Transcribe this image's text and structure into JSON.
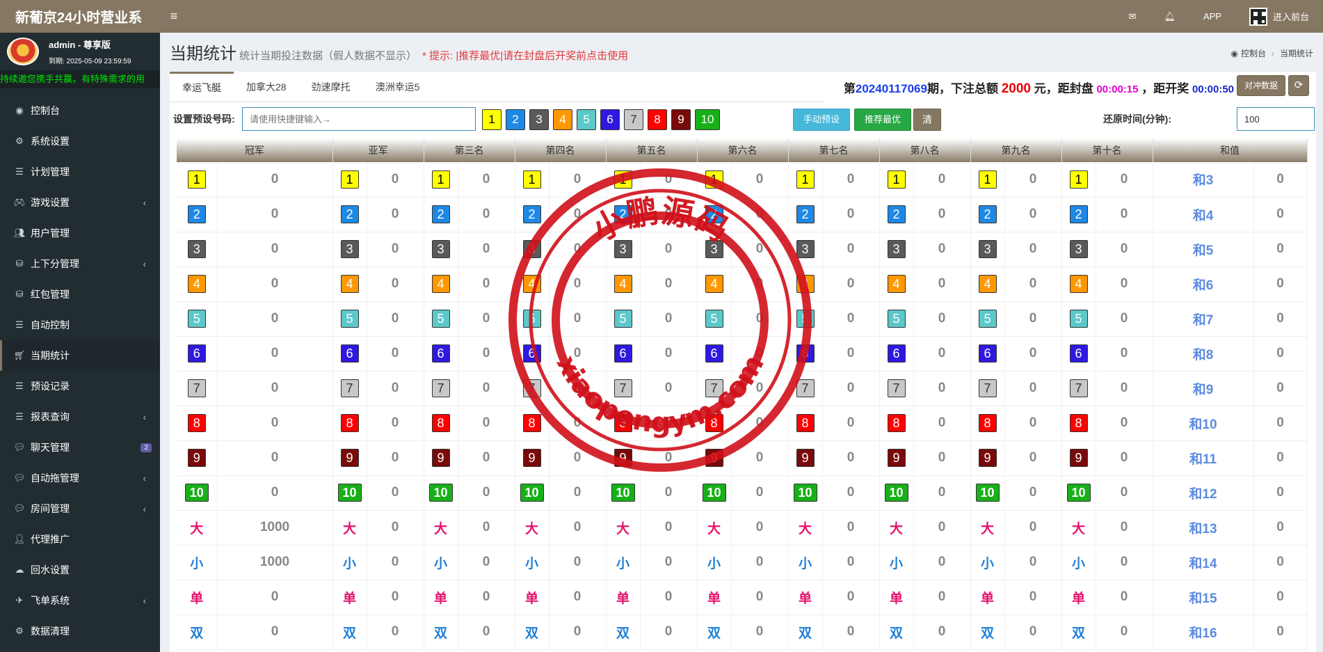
{
  "app": {
    "title": "新葡京24小时营业系"
  },
  "topbar": {
    "mail_icon": "envelope-icon",
    "bell_icon": "bell-icon",
    "app_label": "APP",
    "frontend_label": "进入前台"
  },
  "user": {
    "name": "admin - 尊享版",
    "expire": "到期: 2025-05-09 23:59:59"
  },
  "marquee": "持续邀您携手共赢，有特殊需求的用",
  "menu": [
    {
      "label": "控制台",
      "icon": "dashboard-icon",
      "arrow": false
    },
    {
      "label": "系统设置",
      "icon": "cogs-icon",
      "arrow": false
    },
    {
      "label": "计划管理",
      "icon": "list-icon",
      "arrow": false
    },
    {
      "label": "游戏设置",
      "icon": "gamepad-icon",
      "arrow": true
    },
    {
      "label": "用户管理",
      "icon": "users-icon",
      "arrow": false
    },
    {
      "label": "上下分管理",
      "icon": "database-icon",
      "arrow": true
    },
    {
      "label": "红包管理",
      "icon": "database-icon",
      "arrow": false
    },
    {
      "label": "自动控制",
      "icon": "list-icon",
      "arrow": false
    },
    {
      "label": "当期统计",
      "icon": "cart-icon",
      "arrow": false,
      "active": true
    },
    {
      "label": "预设记录",
      "icon": "list-icon",
      "arrow": false
    },
    {
      "label": "报表查询",
      "icon": "list-icon",
      "arrow": true
    },
    {
      "label": "聊天管理",
      "icon": "chat-icon",
      "arrow": false,
      "badge": "2"
    },
    {
      "label": "自动拖管理",
      "icon": "comment-icon",
      "arrow": true
    },
    {
      "label": "房间管理",
      "icon": "chat-icon",
      "arrow": true
    },
    {
      "label": "代理推广",
      "icon": "user-plus-icon",
      "arrow": false
    },
    {
      "label": "回水设置",
      "icon": "cloud-icon",
      "arrow": false
    },
    {
      "label": "飞单系统",
      "icon": "send-icon",
      "arrow": true
    },
    {
      "label": "数据清理",
      "icon": "gear-icon",
      "arrow": false
    }
  ],
  "page": {
    "title": "当期统计",
    "subtitle": "统计当期投注数据（假人数据不显示）",
    "hint": "* 提示: |推荐最优|请在封盘后开奖前点击使用",
    "breadcrumb": [
      "控制台",
      "当期统计"
    ]
  },
  "tabs": [
    "幸运飞艇",
    "加拿大28",
    "劲速摩托",
    "澳洲幸运5"
  ],
  "issue": {
    "prefix": "第",
    "number": "20240117069",
    "mid": "期，下注总额",
    "total": "2000",
    "unit": "元，距封盘",
    "close_time": "00:00:15",
    "mid2": "，距开奖",
    "draw_time": "00:00:50"
  },
  "buttons": {
    "compare": "对冲数据",
    "manual": "手动预设",
    "best": "推荐最优",
    "clear": "清"
  },
  "preset": {
    "label": "设置预设号码:",
    "placeholder": "请使用快捷键输入→"
  },
  "restore": {
    "label": "还原时间(分钟):",
    "value": "100"
  },
  "num_colors": {
    "1": {
      "bg": "#ffff00",
      "fg": "#000000"
    },
    "2": {
      "bg": "#1e88e5",
      "fg": "#ffffff"
    },
    "3": {
      "bg": "#5a5a5a",
      "fg": "#ffffff"
    },
    "4": {
      "bg": "#ff9800",
      "fg": "#ffffff"
    },
    "5": {
      "bg": "#5bc8c9",
      "fg": "#ffffff"
    },
    "6": {
      "bg": "#2f19e0",
      "fg": "#ffffff"
    },
    "7": {
      "bg": "#c8c8c8",
      "fg": "#333333"
    },
    "8": {
      "bg": "#ff0000",
      "fg": "#ffffff"
    },
    "9": {
      "bg": "#7a0a0a",
      "fg": "#ffffff"
    },
    "10": {
      "bg": "#18b018",
      "fg": "#ffffff"
    }
  },
  "quick_numbers": [
    "1",
    "2",
    "3",
    "4",
    "5",
    "6",
    "7",
    "8",
    "9",
    "10"
  ],
  "table": {
    "headers": [
      "冠军",
      "亚军",
      "第三名",
      "第四名",
      "第五名",
      "第六名",
      "第七名",
      "第八名",
      "第九名",
      "第十名",
      "和值"
    ],
    "rows": [
      {
        "label": "1",
        "type": "num",
        "champion": "0",
        "others": "0",
        "sum": "和3",
        "sum_val": "0"
      },
      {
        "label": "2",
        "type": "num",
        "champion": "0",
        "others": "0",
        "sum": "和4",
        "sum_val": "0"
      },
      {
        "label": "3",
        "type": "num",
        "champion": "0",
        "others": "0",
        "sum": "和5",
        "sum_val": "0"
      },
      {
        "label": "4",
        "type": "num",
        "champion": "0",
        "others": "0",
        "sum": "和6",
        "sum_val": "0"
      },
      {
        "label": "5",
        "type": "num",
        "champion": "0",
        "others": "0",
        "sum": "和7",
        "sum_val": "0"
      },
      {
        "label": "6",
        "type": "num",
        "champion": "0",
        "others": "0",
        "sum": "和8",
        "sum_val": "0"
      },
      {
        "label": "7",
        "type": "num",
        "champion": "0",
        "others": "0",
        "sum": "和9",
        "sum_val": "0"
      },
      {
        "label": "8",
        "type": "num",
        "champion": "0",
        "others": "0",
        "sum": "和10",
        "sum_val": "0"
      },
      {
        "label": "9",
        "type": "num",
        "champion": "0",
        "others": "0",
        "sum": "和11",
        "sum_val": "0"
      },
      {
        "label": "10",
        "type": "num",
        "champion": "0",
        "others": "0",
        "sum": "和12",
        "sum_val": "0"
      },
      {
        "label": "大",
        "type": "pink",
        "champion": "1000",
        "others": "0",
        "sum": "和13",
        "sum_val": "0"
      },
      {
        "label": "小",
        "type": "blue",
        "champion": "1000",
        "others": "0",
        "sum": "和14",
        "sum_val": "0"
      },
      {
        "label": "单",
        "type": "pink",
        "champion": "0",
        "others": "0",
        "sum": "和15",
        "sum_val": "0"
      },
      {
        "label": "双",
        "type": "blue",
        "champion": "0",
        "others": "0",
        "sum": "和16",
        "sum_val": "0"
      }
    ]
  },
  "watermark": {
    "top_text": "小鹏源码",
    "bottom_text": "xiaopengym.com",
    "color": "#d0101a"
  }
}
